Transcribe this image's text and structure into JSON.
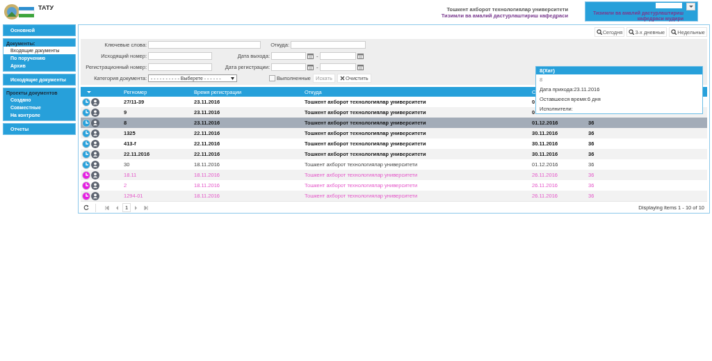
{
  "header": {
    "title": "ТАТУ",
    "org_lines": [
      "Тошкент ахборот технологиялар университети",
      "Тизимли ва амалий дастурлаштириш кафедраси"
    ],
    "user_lines": [
      "Тизимли ва амалий дастурлаштириш",
      "кафедраси мудири"
    ]
  },
  "sidebar": [
    {
      "items": [
        {
          "label": "Основной",
          "selected": false
        }
      ]
    },
    {
      "heading": "Документы:",
      "items": [
        {
          "label": "Входящие документы",
          "selected": true
        },
        {
          "label": "По поручению",
          "selected": false
        },
        {
          "label": "Архив",
          "selected": false
        }
      ]
    },
    {
      "items": [
        {
          "label": "Исходящие документы",
          "selected": false
        }
      ]
    },
    {
      "heading": "Проекты документов",
      "items": [
        {
          "label": "Создано",
          "selected": false
        },
        {
          "label": "Совместные",
          "selected": false
        },
        {
          "label": "На контроле",
          "selected": false
        }
      ]
    },
    {
      "items": [
        {
          "label": "Отчеты",
          "selected": false
        }
      ]
    }
  ],
  "quick_filters": [
    "Сегодня",
    "3-х дневные",
    "Недельные"
  ],
  "filters": {
    "keywords": {
      "label": "Ключевые слова:"
    },
    "from": {
      "label": "Откуда:"
    },
    "outgoing_number": {
      "label": "Исходящий номер:"
    },
    "exit_date": {
      "label": "Дата выхода:"
    },
    "reg_number": {
      "label": "Регистрационный номер:"
    },
    "reg_date": {
      "label": "Дата регистрации:"
    },
    "range_separator": "-",
    "category": {
      "label": "Категория документа:",
      "value": "- - - - - - - - - - Выберете - - - - - -"
    },
    "done": {
      "label": "Выполненные",
      "checked": false
    },
    "search_button": "Искать",
    "clear_button": "Очистить"
  },
  "table": {
    "columns": [
      "Регномер",
      "Время регистрации",
      "Откуда",
      "С"
    ],
    "rows": [
      {
        "kind": "unread",
        "selected": false,
        "cells": [
          "27/11-39",
          "23.11.2016",
          "Тошкент ахборот технологиялар университети",
          "0"
        ]
      },
      {
        "kind": "unread",
        "selected": false,
        "cells": [
          "9",
          "23.11.2016",
          "Тошкент ахборот технологиялар университети",
          "0"
        ]
      },
      {
        "kind": "unread",
        "selected": true,
        "cells": [
          "8",
          "23.11.2016",
          "Тошкент ахборот технологиялар университети",
          "01.12.2016",
          "36"
        ]
      },
      {
        "kind": "unread",
        "selected": false,
        "cells": [
          "1325",
          "22.11.2016",
          "Тошкент ахборот технологиялар университети",
          "30.11.2016",
          "36"
        ]
      },
      {
        "kind": "unread",
        "selected": false,
        "cells": [
          "413-f",
          "22.11.2016",
          "Тошкент ахборот технологиялар университети",
          "30.11.2016",
          "36"
        ]
      },
      {
        "kind": "unread",
        "selected": false,
        "cells": [
          "22.11.2016",
          "22.11.2016",
          "Тошкент ахборот технологиялар университети",
          "30.11.2016",
          "36"
        ]
      },
      {
        "kind": "read",
        "selected": false,
        "cells": [
          "30",
          "18.11.2016",
          "Тошкент ахборот технологиялар университети",
          "01.12.2016",
          "36"
        ]
      },
      {
        "kind": "overdue",
        "selected": false,
        "cells": [
          "18.11",
          "18.11.2016",
          "Тошкент ахборот технологиялар университети",
          "26.11.2016",
          "36"
        ]
      },
      {
        "kind": "overdue",
        "selected": false,
        "cells": [
          "2",
          "18.11.2016",
          "Тошкент ахборот технологиялар университети",
          "26.11.2016",
          "36"
        ]
      },
      {
        "kind": "overdue",
        "selected": false,
        "cells": [
          "1294-01",
          "18.11.2016",
          "Тошкент ахборот технологиялар университети",
          "26.11.2016",
          "36"
        ]
      }
    ],
    "pager": {
      "page": "1",
      "summary": "Displaying items 1 - 10 of 10"
    }
  },
  "tooltip": {
    "title": "8(Хат)",
    "number": "8",
    "lines": [
      "Дата прихода:23.11.2016",
      "Оставшееся время:6 дня",
      "Исполнители:"
    ]
  }
}
